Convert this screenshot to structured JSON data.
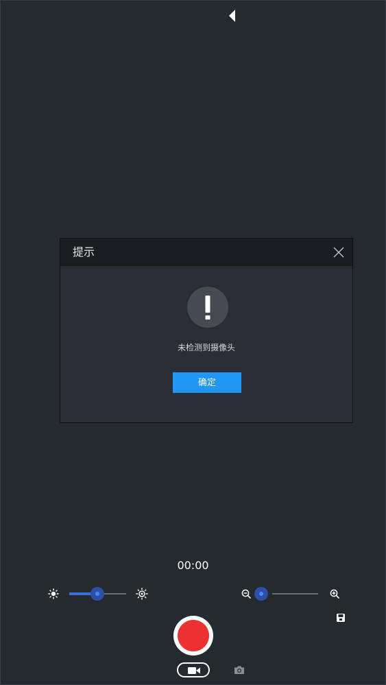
{
  "dialog": {
    "title": "提示",
    "message": "未检测到摄像头",
    "confirm_label": "确定"
  },
  "recording": {
    "timer": "00:00"
  },
  "brightness": {
    "level": 0.5
  },
  "zoom": {
    "level": 0.0
  },
  "colors": {
    "background": "#252a31",
    "accent": "#2196f3",
    "record": "#ee3030",
    "slider_active": "#2d4fa8"
  },
  "icons": {
    "back": "back-triangle-icon",
    "close": "close-icon",
    "warning": "exclamation-icon",
    "brightness_down": "brightness-low-icon",
    "brightness_up": "brightness-high-icon",
    "zoom_out": "zoom-out-icon",
    "zoom_in": "zoom-in-icon",
    "video_mode": "video-camera-icon",
    "photo_mode": "camera-icon",
    "save": "save-icon"
  }
}
